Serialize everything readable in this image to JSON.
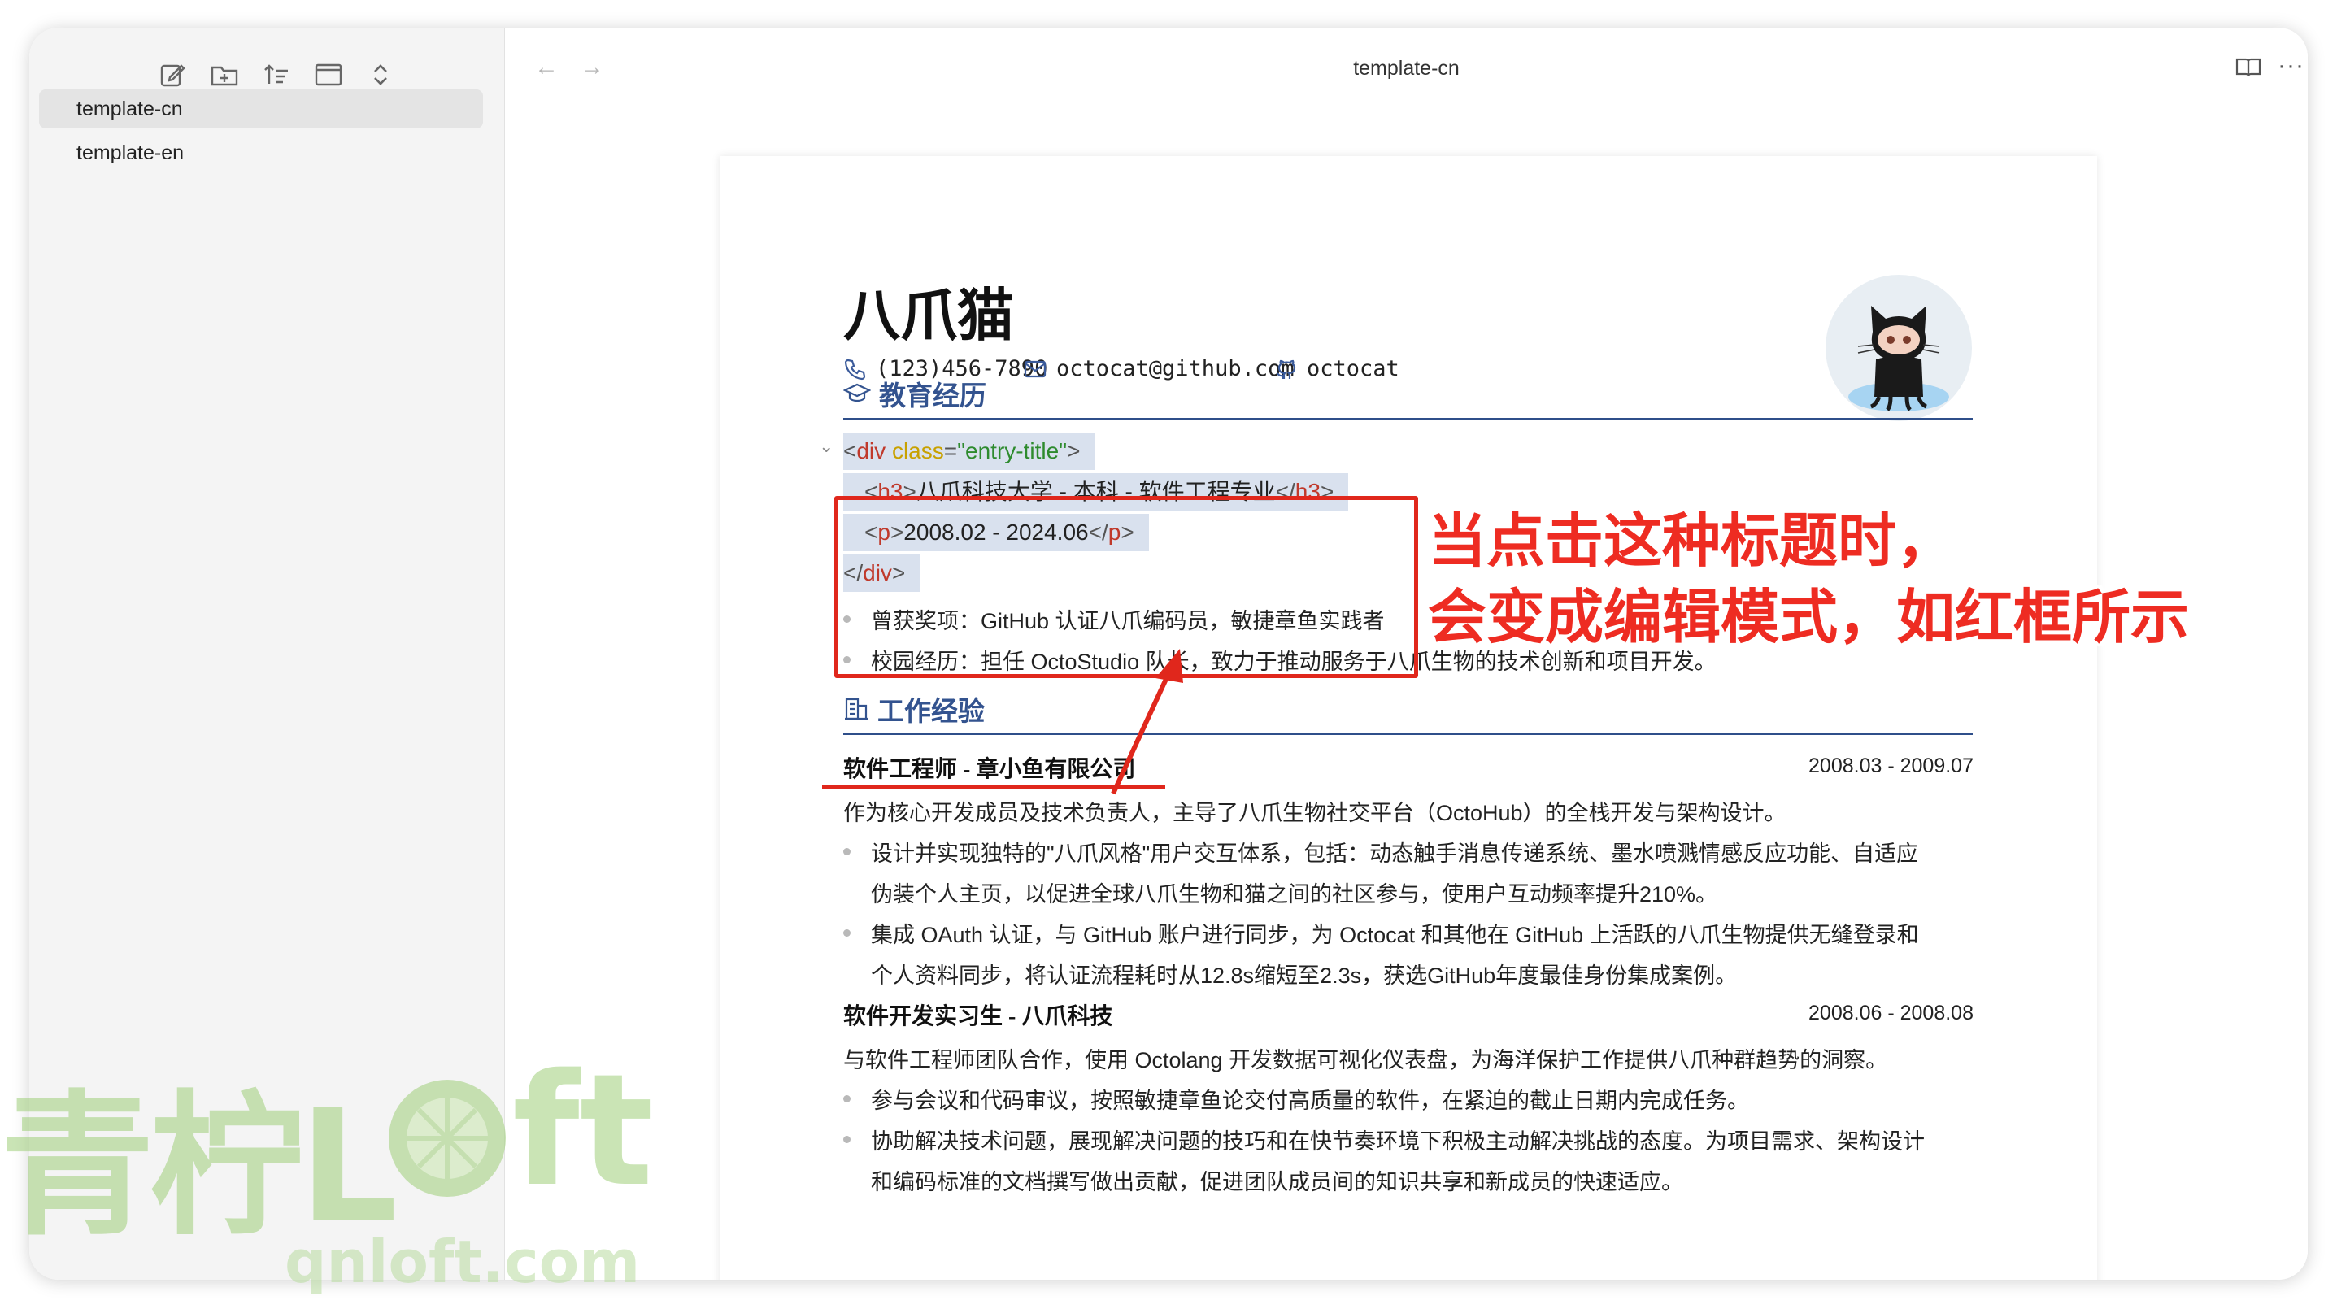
{
  "window": {
    "title": "template-cn"
  },
  "sidebar": {
    "toolbar_icons": [
      "new-file-icon",
      "new-folder-icon",
      "sort-icon",
      "layout-icon",
      "expand-collapse-icon"
    ],
    "files": [
      {
        "label": "template-cn",
        "active": true
      },
      {
        "label": "template-en",
        "active": false
      }
    ]
  },
  "resume": {
    "name": "八爪猫",
    "phone": "(123)456-7890",
    "email": "octocat@github.com",
    "github": "octocat",
    "education": {
      "heading": "教育经历",
      "code": {
        "open_tag": "div",
        "attr_name": "class",
        "attr_value": "\"entry-title\"",
        "h3_tag": "h3",
        "h3_text": "八爪科技大学 - 本科 - 软件工程专业",
        "p_tag": "p",
        "p_text": "2008.02 - 2024.06",
        "close_div": "div",
        "eq": "="
      },
      "bullets": [
        "曾获奖项：GitHub 认证八爪编码员，敏捷章鱼实践者",
        "校园经历：担任 OctoStudio 队长，致力于推动服务于八爪生物的技术创新和项目开发。"
      ]
    },
    "work": {
      "heading": "工作经验",
      "jobs": [
        {
          "title": "软件工程师 - 章小鱼有限公司",
          "date": "2008.03 - 2009.07",
          "summary": "作为核心开发成员及技术负责人，主导了八爪生物社交平台（OctoHub）的全栈开发与架构设计。",
          "bullets": [
            [
              "设计并实现独特的\"八爪风格\"用户交互体系，包括：动态触手消息传递系统、墨水喷溅情感反应功能、自适应",
              "伪装个人主页，以促进全球八爪生物和猫之间的社区参与，使用户互动频率提升210%。"
            ],
            [
              "集成 OAuth 认证，与 GitHub 账户进行同步，为 Octocat 和其他在 GitHub 上活跃的八爪生物提供无缝登录和",
              "个人资料同步，将认证流程耗时从12.8s缩短至2.3s，获选GitHub年度最佳身份集成案例。"
            ]
          ]
        },
        {
          "title": "软件开发实习生 - 八爪科技",
          "date": "2008.06 - 2008.08",
          "summary": "与软件工程师团队合作，使用 Octolang 开发数据可视化仪表盘，为海洋保护工作提供八爪种群趋势的洞察。",
          "bullets": [
            [
              "参与会议和代码审议，按照敏捷章鱼论交付高质量的软件，在紧迫的截止日期内完成任务。"
            ],
            [
              "协助解决技术问题，展现解决问题的技巧和在快节奏环境下积极主动解决挑战的态度。为项目需求、架构设计",
              "和编码标准的文档撰写做出贡献，促进团队成员间的知识共享和新成员的快速适应。"
            ]
          ]
        }
      ]
    }
  },
  "annotation": {
    "line1": "当点击这种标题时，",
    "line2": "会变成编辑模式，如红框所示",
    "color": "#ee2c22"
  },
  "watermark": {
    "main": "青柠L",
    "tail": "ft",
    "domain": "qnloft.com",
    "color": "#9fcf7a"
  }
}
